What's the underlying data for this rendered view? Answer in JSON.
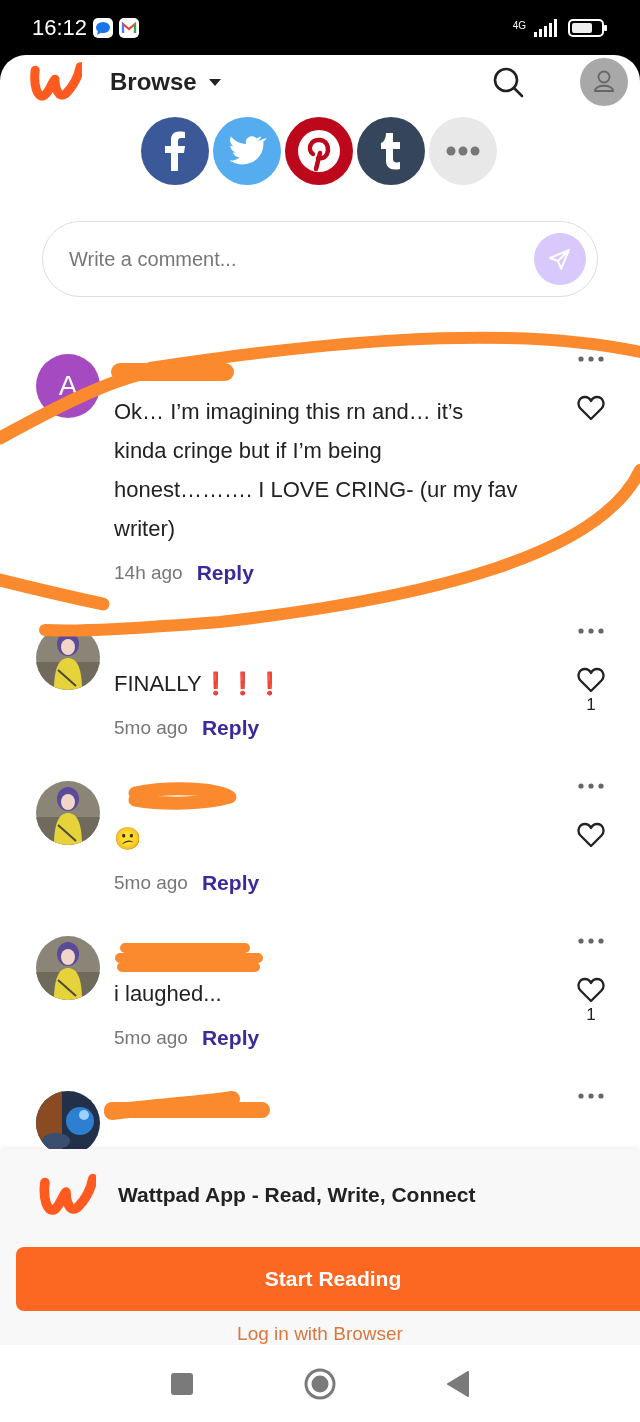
{
  "status_bar": {
    "time": "16:12",
    "network": "4G"
  },
  "header": {
    "menu_label": "Browse"
  },
  "share_buttons": [
    {
      "kind": "facebook"
    },
    {
      "kind": "twitter"
    },
    {
      "kind": "pinterest"
    },
    {
      "kind": "tumblr"
    },
    {
      "kind": "more"
    }
  ],
  "comment_field": {
    "placeholder": "Write a comment..."
  },
  "comments": [
    {
      "avatar": {
        "kind": "letter",
        "letter": "A"
      },
      "body": "Ok… I’m imagining this rn and… it’s kinda cringe but if I’m being honest………. I LOVE CRING- (ur my fav writer)",
      "time": "14h ago",
      "reply": "Reply"
    },
    {
      "avatar": {
        "kind": "picture"
      },
      "body": "FINALLY❗❗❗",
      "time": "5mo ago",
      "reply": "Reply",
      "likes": "1"
    },
    {
      "avatar": {
        "kind": "picture"
      },
      "body": "😕",
      "time": "5mo ago",
      "reply": "Reply"
    },
    {
      "avatar": {
        "kind": "picture"
      },
      "body": "i laughed...",
      "time": "5mo ago",
      "reply": "Reply",
      "likes": "1"
    },
    {
      "avatar": {
        "kind": "picture"
      }
    }
  ],
  "app_banner": {
    "title": "Wattpad App - Read, Write, Connect",
    "button": "Start Reading",
    "link": "Log in with Browser"
  }
}
